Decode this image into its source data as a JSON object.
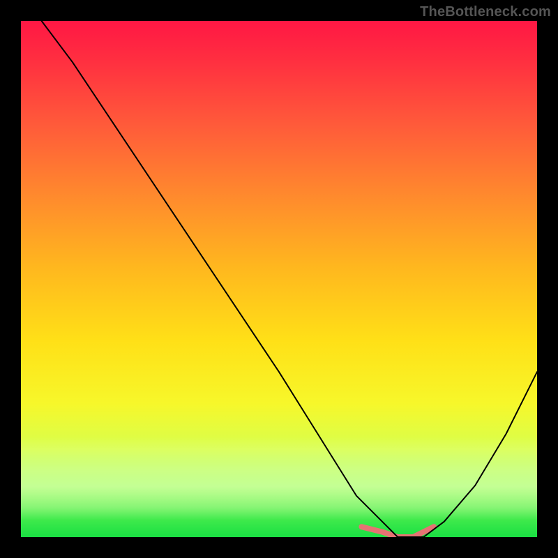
{
  "watermark": "TheBottleneck.com",
  "chart_data": {
    "type": "line",
    "title": "",
    "xlabel": "",
    "ylabel": "",
    "xlim": [
      0,
      100
    ],
    "ylim": [
      0,
      100
    ],
    "background_gradient": {
      "top": "#ff1744",
      "bottom": "#1adf43",
      "stops": [
        {
          "pos": 0.0,
          "color": "#ff1744"
        },
        {
          "pos": 0.34,
          "color": "#ff8a2d"
        },
        {
          "pos": 0.62,
          "color": "#ffe017"
        },
        {
          "pos": 0.83,
          "color": "#d7ff4d"
        },
        {
          "pos": 1.0,
          "color": "#1adf43"
        }
      ]
    },
    "series": [
      {
        "name": "curve",
        "color": "#000000",
        "stroke_width": 2,
        "x": [
          4,
          10,
          20,
          30,
          40,
          50,
          55,
          60,
          65,
          70,
          73,
          78,
          82,
          88,
          94,
          100
        ],
        "y": [
          100,
          92,
          77,
          62,
          47,
          32,
          24,
          16,
          8,
          3,
          0,
          0,
          3,
          10,
          20,
          32
        ]
      },
      {
        "name": "trough-marker",
        "color": "#e57373",
        "stroke_width": 8,
        "x": [
          66,
          70,
          73,
          76,
          80
        ],
        "y": [
          2,
          1,
          0,
          0,
          2
        ]
      }
    ]
  }
}
